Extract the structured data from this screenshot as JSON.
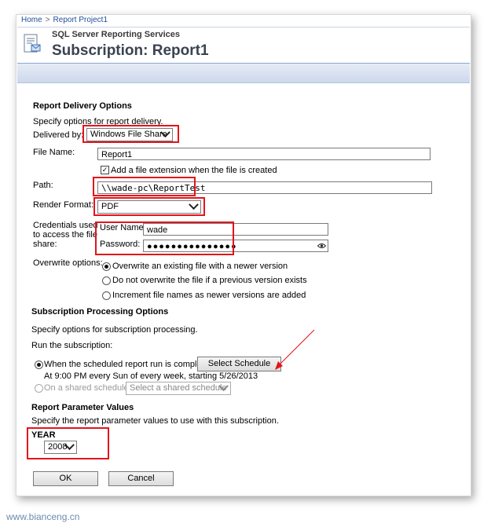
{
  "breadcrumb": {
    "home": "Home",
    "separator": ">",
    "project": "Report Project1"
  },
  "header": {
    "app_title": "SQL Server Reporting Services",
    "page_title": "Subscription: Report1"
  },
  "delivery": {
    "heading": "Report Delivery Options",
    "description": "Specify options for report delivery.",
    "delivered_by_label": "Delivered by:",
    "delivered_by_value": "Windows File Share",
    "file_name_label": "File Name:",
    "file_name_value": "Report1",
    "extension_label": "Add a file extension when the file is created",
    "extension_checked": true,
    "path_label": "Path:",
    "path_value": "\\\\wade-pc\\ReportTest",
    "render_format_label": "Render Format:",
    "render_format_value": "PDF",
    "credentials_label_1": "Credentials used",
    "credentials_label_2": "to access the file",
    "credentials_label_3": "share:",
    "username_label": "User Name:",
    "username_value": "wade",
    "password_label": "Password:",
    "password_value": "●●●●●●●●●●●●●●●",
    "overwrite_label": "Overwrite options:",
    "overwrite_options": [
      "Overwrite an existing file with a newer version",
      "Do not overwrite the file if a previous version exists",
      "Increment file names as newer versions are added"
    ],
    "overwrite_selected_index": 0
  },
  "processing": {
    "heading": "Subscription Processing Options",
    "description": "Specify options for subscription processing.",
    "run_label": "Run the subscription:",
    "scheduled_label": "When the scheduled report run is complete.",
    "select_schedule_button": "Select Schedule",
    "schedule_summary": "At 9:00 PM every Sun of every week, starting 5/26/2013",
    "shared_label": "On a shared schedule:",
    "shared_select_placeholder": "Select a shared schedule"
  },
  "parameters": {
    "heading": "Report Parameter Values",
    "description": "Specify the report parameter values to use with this subscription.",
    "year_label": "YEAR",
    "year_value": "2008"
  },
  "actions": {
    "ok": "OK",
    "cancel": "Cancel"
  },
  "watermark": "www.bianceng.cn",
  "colors": {
    "highlight": "#e3141b",
    "link": "#1f4e9a",
    "bar": "#cdd8ec"
  }
}
